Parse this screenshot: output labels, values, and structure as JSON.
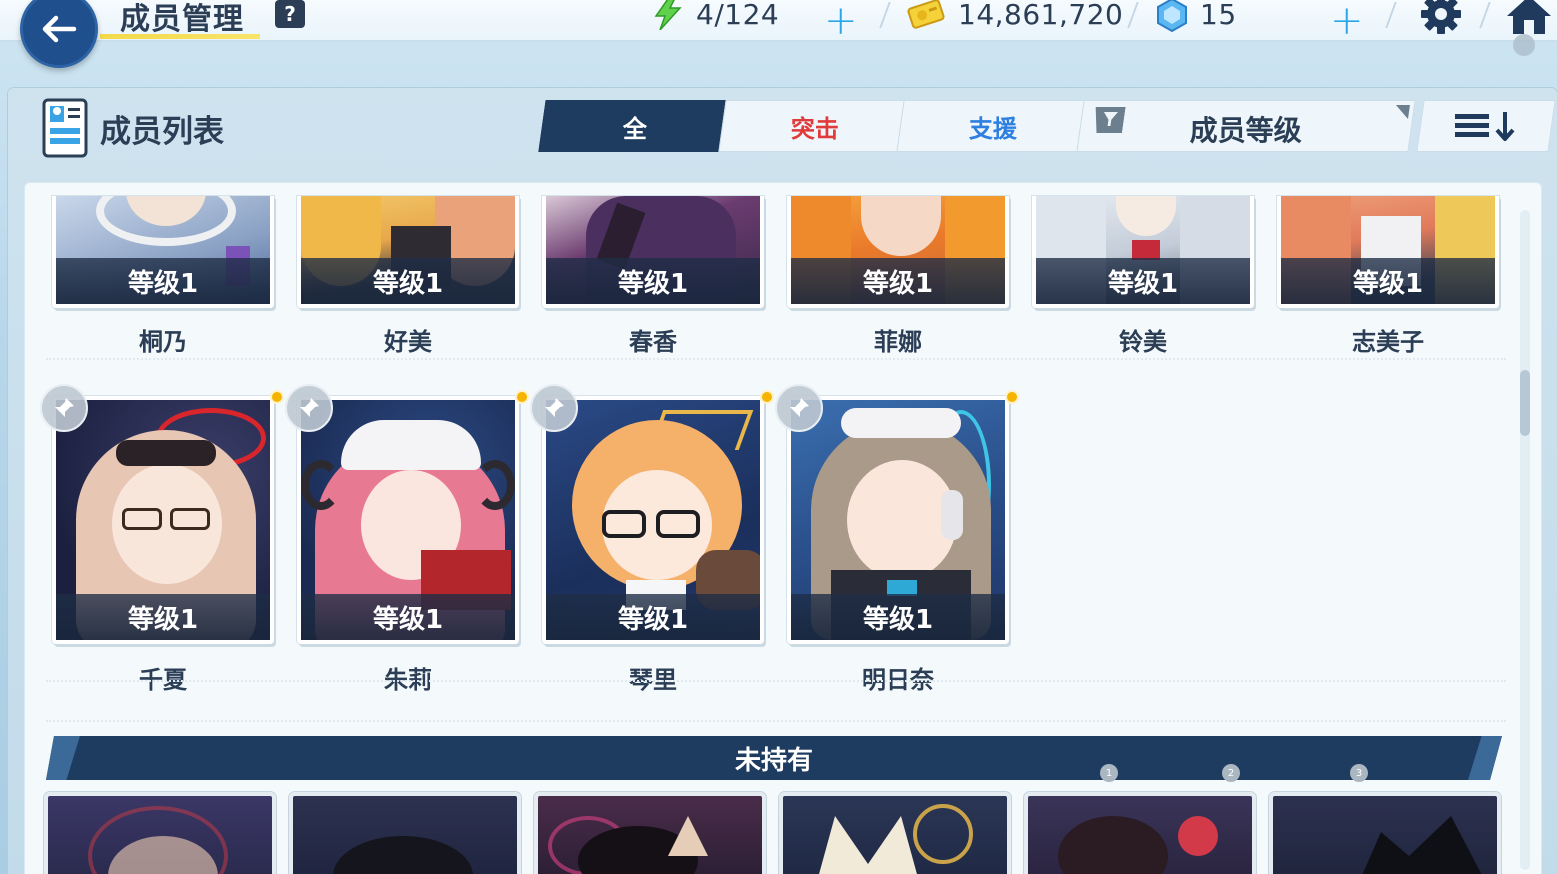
{
  "topbar": {
    "title": "成员管理",
    "help": "?",
    "ap": "4/124",
    "credits": "14,861,720",
    "gems": "15"
  },
  "panel": {
    "title": "成员列表",
    "tabs": [
      {
        "label": "全",
        "active": true
      },
      {
        "label": "突击",
        "active": false
      },
      {
        "label": "支援",
        "active": false
      }
    ],
    "filter_label": "成员等级"
  },
  "owned_row1": [
    {
      "name": "桐乃",
      "level": "等级1"
    },
    {
      "name": "好美",
      "level": "等级1"
    },
    {
      "name": "春香",
      "level": "等级1"
    },
    {
      "name": "菲娜",
      "level": "等级1"
    },
    {
      "name": "铃美",
      "level": "等级1"
    },
    {
      "name": "志美子",
      "level": "等级1"
    }
  ],
  "owned_row2": [
    {
      "name": "千夏",
      "level": "等级1"
    },
    {
      "name": "朱莉",
      "level": "等级1"
    },
    {
      "name": "琴里",
      "level": "等级1"
    },
    {
      "name": "明日奈",
      "level": "等级1"
    }
  ],
  "section": {
    "not_owned": "未持有"
  },
  "colors": {
    "navy": "#1e3b60",
    "striker": "#e03b3b",
    "special": "#2f7fe0",
    "accent_yellow": "#f3d94a",
    "plus_blue": "#2aa6e8"
  }
}
